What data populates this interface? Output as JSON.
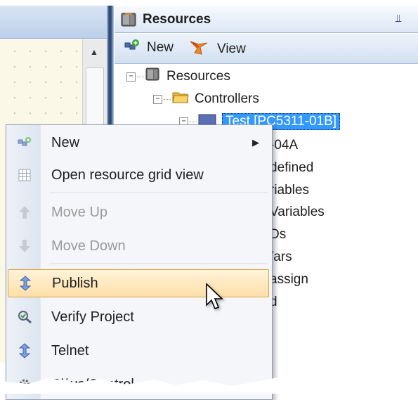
{
  "panel": {
    "title": "Resources",
    "title_icon": "resources-cabinet-icon",
    "pin_icon": "pin-icon",
    "pin_glyph": "⫫"
  },
  "toolbar": {
    "new_label": "New",
    "new_icon": "new-resource-icon",
    "view_label": "View",
    "view_icon": "view-icon"
  },
  "tree": {
    "expander_minus": "−",
    "root": "Resources",
    "controllers": "Controllers",
    "selected": "Test [PC5311-01B]",
    "partial_rows": [
      "-04A",
      "defined",
      "riables",
      "Variables",
      "Ds",
      "/ars",
      "assign",
      "d"
    ]
  },
  "context_menu": {
    "items": [
      {
        "label": "New",
        "icon": "new-icon",
        "enabled": true,
        "submenu": true
      },
      {
        "label": "Open resource grid view",
        "icon": "grid-view-icon",
        "enabled": true
      },
      {
        "label": "Move Up",
        "icon": "arrow-up-icon",
        "enabled": false
      },
      {
        "label": "Move Down",
        "icon": "arrow-down-icon",
        "enabled": false
      },
      {
        "label": "Publish",
        "icon": "publish-icon",
        "enabled": true,
        "hovered": true
      },
      {
        "label": "Verify Project",
        "icon": "verify-icon",
        "enabled": true
      },
      {
        "label": "Telnet",
        "icon": "telnet-icon",
        "enabled": true
      },
      {
        "label": "S˙˙us/Control",
        "icon": "status-control-icon",
        "enabled": true
      }
    ],
    "submenu_arrow": "▶"
  },
  "editor": {
    "scroll_up_glyph": "▲"
  },
  "colors": {
    "selection": "#3399ff",
    "hover_fill": "#fde0a9",
    "hover_border": "#e0a040",
    "panel_header": "#dbe6f5"
  }
}
